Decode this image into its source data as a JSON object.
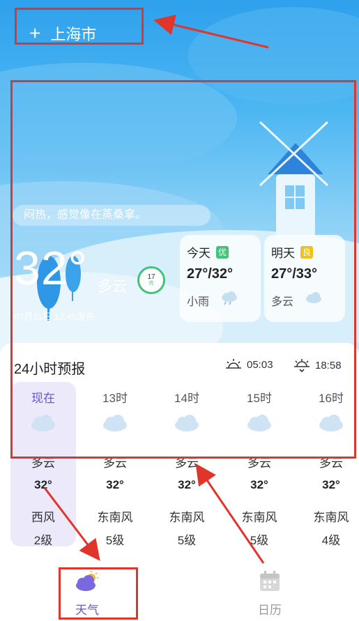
{
  "header": {
    "add_icon": "+",
    "city": "上海市"
  },
  "current": {
    "tip": "闷热，感觉像在蒸桑拿。",
    "temperature": "32°",
    "condition": "多云",
    "aqi_value": "17",
    "aqi_label": "优",
    "publish_time": "07月11日 12:45发布"
  },
  "forecast_cards": [
    {
      "day": "今天",
      "quality": "优",
      "quality_color": "#41c37a",
      "range": "27°/32°",
      "desc": "小雨",
      "icon": "rain-cloud-icon"
    },
    {
      "day": "明天",
      "quality": "良",
      "quality_color": "#f0c020",
      "range": "27°/33°",
      "desc": "多云",
      "icon": "cloud-icon"
    }
  ],
  "hourly": {
    "title": "24小时预报",
    "sunrise": "05:03",
    "sunset": "18:58",
    "items": [
      {
        "time": "现在",
        "cond": "多云",
        "temp": "32°",
        "wind": "西风",
        "level": "2级"
      },
      {
        "time": "13时",
        "cond": "多云",
        "temp": "32°",
        "wind": "东南风",
        "level": "5级"
      },
      {
        "time": "14时",
        "cond": "多云",
        "temp": "32°",
        "wind": "东南风",
        "level": "5级"
      },
      {
        "time": "15时",
        "cond": "多云",
        "temp": "32°",
        "wind": "东南风",
        "level": "5级"
      },
      {
        "time": "16时",
        "cond": "多云",
        "temp": "32°",
        "wind": "东南风",
        "level": "4级"
      }
    ]
  },
  "tabs": [
    {
      "label": "天气",
      "active": true,
      "icon": "weather-icon"
    },
    {
      "label": "日历",
      "active": false,
      "icon": "calendar-icon"
    }
  ],
  "colors": {
    "accent": "#6a55d6",
    "annotation_red": "#e0352b",
    "sky": "#2ea0ec"
  }
}
